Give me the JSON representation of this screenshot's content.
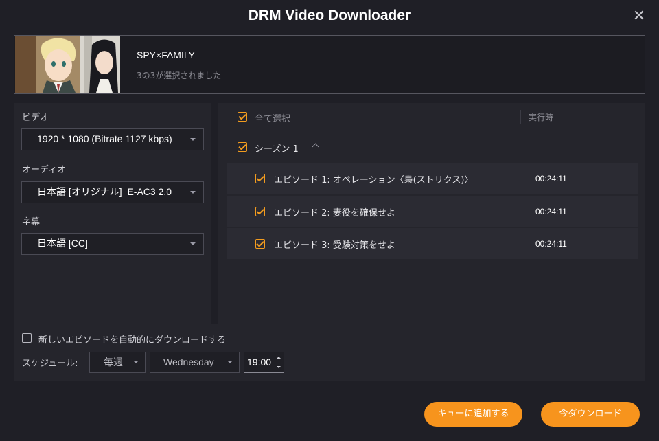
{
  "window": {
    "title": "DRM Video Downloader",
    "close_icon": "close-icon"
  },
  "show": {
    "title": "SPY×FAMILY",
    "selection_status": "3の3が選択されました"
  },
  "video": {
    "label": "ビデオ",
    "value": "1920 * 1080 (Bitrate 1127 kbps)"
  },
  "audio": {
    "label": "オーディオ",
    "value": "日本語 [オリジナル]  E-AC3 2.0"
  },
  "subtitle": {
    "label": "字幕",
    "value": "日本語 [CC]"
  },
  "list": {
    "select_all_label": "全て選択",
    "duration_header": "実行時",
    "season_label": "シーズン 1",
    "episodes": [
      {
        "title": "エピソード 1: オペレーション〈梟(ストリクス)〉",
        "duration": "00:24:11"
      },
      {
        "title": "エピソード 2: 妻役を確保せよ",
        "duration": "00:24:11"
      },
      {
        "title": "エピソード 3: 受験対策をせよ",
        "duration": "00:24:11"
      }
    ]
  },
  "schedule": {
    "auto_download_label": "新しいエピソードを自動的にダウンロードする",
    "auto_download_checked": false,
    "label": "スケジュール:",
    "frequency": "毎週",
    "day": "Wednesday",
    "time": "19:00"
  },
  "actions": {
    "add_to_queue": "キューに追加する",
    "download_now": "今ダウンロード"
  },
  "colors": {
    "accent": "#f7941d",
    "background": "#1f1f26",
    "panel": "#25252c"
  }
}
